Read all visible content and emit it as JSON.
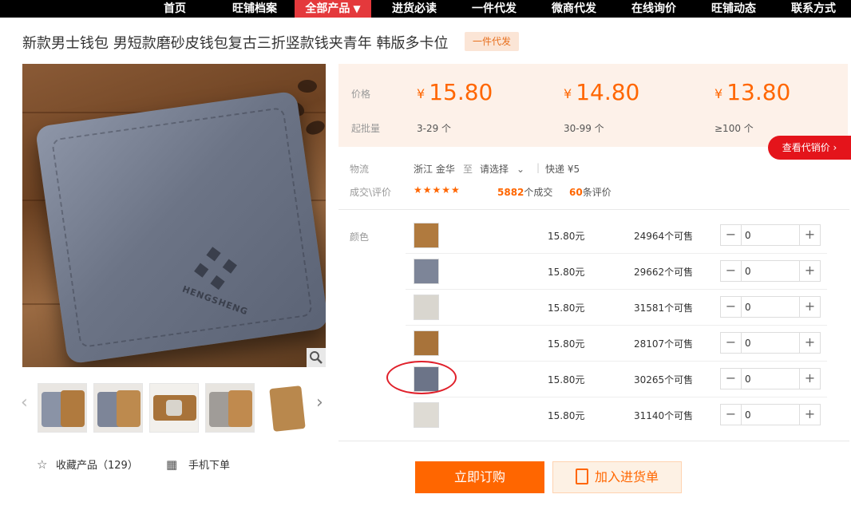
{
  "nav": {
    "items": [
      "首页",
      "旺铺档案",
      "全部产品",
      "进货必读",
      "一件代发",
      "微商代发",
      "在线询价",
      "旺铺动态",
      "联系方式"
    ],
    "active_caret": "▼"
  },
  "product": {
    "title": "新款男士钱包 男短款磨砂皮钱包复古三折竖款钱夹青年 韩版多卡位",
    "tag": "一件代发",
    "wallet_brand": "HENGSHENG"
  },
  "pricing": {
    "price_label": "价格",
    "batch_label": "起批量",
    "currency": "¥",
    "tiers": [
      {
        "price": "15.80",
        "qty": "3-29 个"
      },
      {
        "price": "14.80",
        "qty": "30-99 个"
      },
      {
        "price": "13.80",
        "qty": "≥100 个"
      }
    ],
    "agent_button": "查看代销价 ›"
  },
  "logistics": {
    "label": "物流",
    "from": "浙江 金华",
    "to_word": "至",
    "destination": "请选择",
    "express": "快递 ¥5"
  },
  "reviews": {
    "label": "成交\\评价",
    "rating": 4.5,
    "stars": "★★★★★",
    "deals": "5882",
    "deals_suffix": "个成交",
    "count": "60",
    "count_suffix": "条评价"
  },
  "sku": {
    "color_label": "颜色",
    "rows": [
      {
        "price": "15.80元",
        "stock": "24964个可售",
        "qty": "0",
        "swatch": "#b07a3e"
      },
      {
        "price": "15.80元",
        "stock": "29662个可售",
        "qty": "0",
        "swatch": "#7d8598"
      },
      {
        "price": "15.80元",
        "stock": "31581个可售",
        "qty": "0",
        "swatch": "#d9d6cf"
      },
      {
        "price": "15.80元",
        "stock": "28107个可售",
        "qty": "0",
        "swatch": "#a8733a"
      },
      {
        "price": "15.80元",
        "stock": "30265个可售",
        "qty": "0",
        "swatch": "#6c7488"
      },
      {
        "price": "15.80元",
        "stock": "31140个可售",
        "qty": "0",
        "swatch": "#dedbd4"
      }
    ]
  },
  "actions": {
    "favorite": "收藏产品（129）",
    "mobile": "手机下单",
    "buy": "立即订购",
    "cart": "加入进货单"
  },
  "icons": {
    "zoom": "search-icon",
    "favorite": "star-icon",
    "mobile": "qrcode-icon",
    "chevron": "chevron-down-icon",
    "cart": "clipboard-icon",
    "prev": "chevron-left-icon",
    "next": "chevron-right-icon"
  },
  "colors": {
    "accent": "#ff6600",
    "nav_active": "#e4393c",
    "agent_red": "#e4141b"
  }
}
